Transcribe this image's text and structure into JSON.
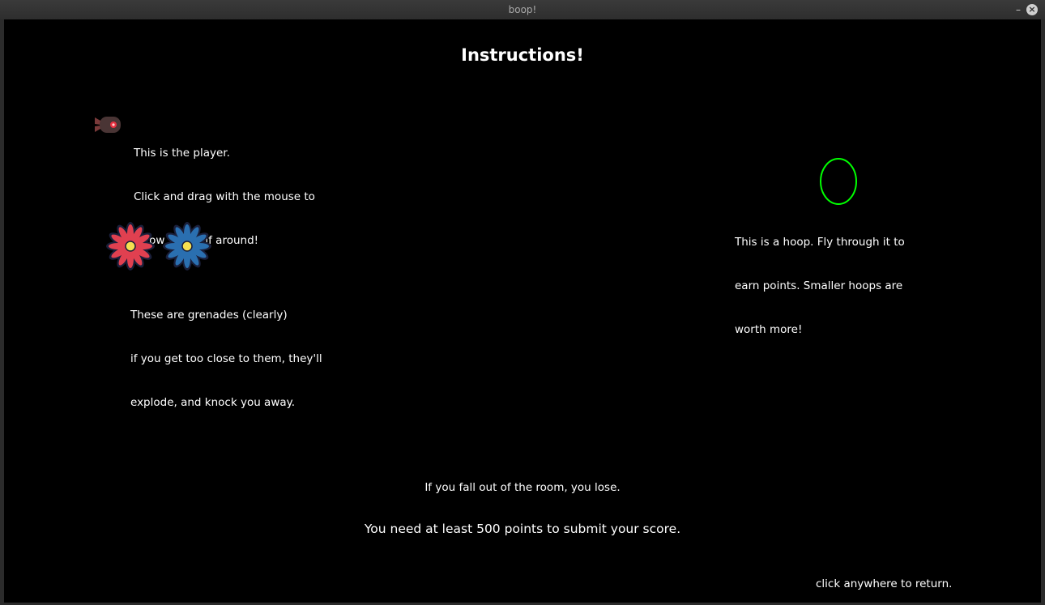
{
  "window": {
    "title": "boop!"
  },
  "screen": {
    "heading": "Instructions!",
    "player": {
      "icon": "player-ship-icon",
      "lines": [
        "This is the player.",
        "Click and drag with the mouse to",
        "throw yourself around!"
      ]
    },
    "grenades": {
      "icons": [
        "red-flower-grenade-icon",
        "blue-flower-grenade-icon"
      ],
      "lines": [
        "These are grenades (clearly)",
        "if you get too close to them, they'll",
        "explode, and knock you away."
      ]
    },
    "hoop": {
      "icon": "hoop-icon",
      "lines": [
        "This is a hoop. Fly through it to",
        "earn points. Smaller hoops are",
        "worth more!"
      ]
    },
    "fall_text": "If you fall out of the room, you lose.",
    "score_text": "You need at least 500 points to submit your score.",
    "return_text": "click anywhere to return."
  },
  "colors": {
    "background": "#000000",
    "text": "#ffffff",
    "hoop": "#00ff00",
    "red_grenade": "#e04050",
    "blue_grenade": "#2a6fb0",
    "grenade_center": "#f5e050"
  }
}
